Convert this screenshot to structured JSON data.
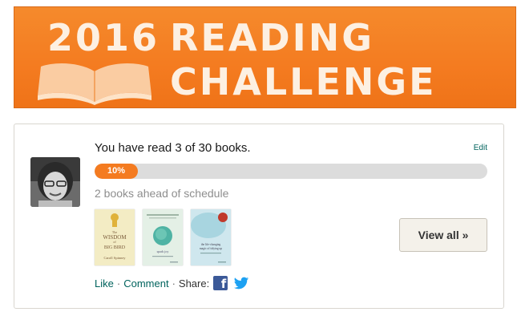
{
  "banner": {
    "year": "2016",
    "word1": "READING",
    "word2": "CHALLENGE",
    "color": "#f47b20"
  },
  "challenge": {
    "status_text": "You have read 3 of 30 books.",
    "edit_label": "Edit",
    "progress_percent": 10,
    "progress_label": "10%",
    "schedule_text": "2 books ahead of schedule",
    "view_all_label": "View all »"
  },
  "books": [
    {
      "title_lines": [
        "The",
        "WISDOM",
        "of",
        "BIG BIRD"
      ],
      "author": "Caroll Spinney",
      "cover_color": "#f3ecc4"
    },
    {
      "title_lines": [
        "spark joy"
      ],
      "author": "",
      "cover_color": "#e4f0e6"
    },
    {
      "title_lines": [
        "the life-changing",
        "magic of tidying up"
      ],
      "author": "",
      "cover_color": "#cfe7ee"
    }
  ],
  "actions": {
    "like": "Like",
    "dot1": "·",
    "comment": "Comment",
    "dot2": "·",
    "share": "Share:"
  },
  "icons": {
    "facebook": "facebook-icon",
    "twitter": "twitter-icon",
    "open_book": "open-book-icon"
  }
}
